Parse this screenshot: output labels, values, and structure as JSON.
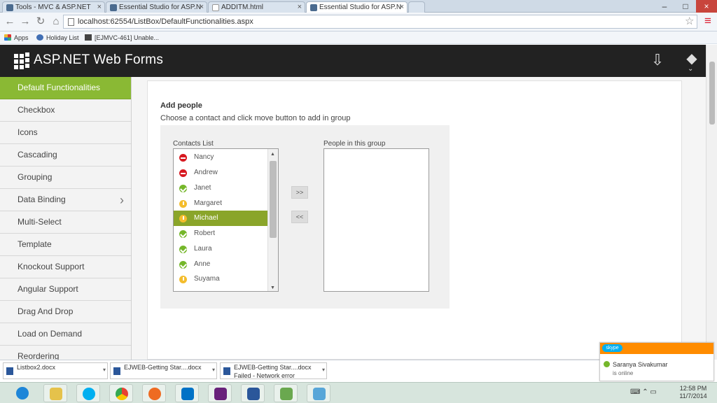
{
  "browser": {
    "tabs": [
      {
        "label": "Tools - MVC & ASP.NET ",
        "active": false
      },
      {
        "label": "Essential Studio for ASP.N",
        "active": false
      },
      {
        "label": "ADDITM.html",
        "active": false
      },
      {
        "label": "Essential Studio for ASP.N",
        "active": true
      }
    ],
    "address": "localhost:62554/ListBox/DefaultFunctionalities.aspx",
    "bookmarks": [
      "Apps",
      "Holiday List",
      "[EJMVC-461] Unable..."
    ]
  },
  "app": {
    "title": "ASP.NET Web Forms"
  },
  "sidebar": {
    "items": [
      {
        "label": "Default Functionalities",
        "active": true
      },
      {
        "label": "Checkbox"
      },
      {
        "label": "Icons"
      },
      {
        "label": "Cascading"
      },
      {
        "label": "Grouping"
      },
      {
        "label": "Data Binding",
        "has_chevron": true
      },
      {
        "label": "Multi-Select"
      },
      {
        "label": "Template"
      },
      {
        "label": "Knockout Support"
      },
      {
        "label": "Angular Support"
      },
      {
        "label": "Drag And Drop"
      },
      {
        "label": "Load on Demand"
      },
      {
        "label": "Reordering"
      }
    ]
  },
  "content": {
    "heading": "Add people",
    "description": "Choose a contact and click move button to add in group",
    "contacts_label": "Contacts List",
    "group_label": "People in this group",
    "move_right": ">>",
    "move_left": "<<",
    "contacts": [
      {
        "name": "Nancy",
        "status": "busy"
      },
      {
        "name": "Andrew",
        "status": "busy"
      },
      {
        "name": "Janet",
        "status": "online"
      },
      {
        "name": "Margaret",
        "status": "away"
      },
      {
        "name": "Michael",
        "status": "away",
        "selected": true
      },
      {
        "name": "Robert",
        "status": "online"
      },
      {
        "name": "Laura",
        "status": "online"
      },
      {
        "name": "Anne",
        "status": "online"
      },
      {
        "name": "Suyama",
        "status": "away"
      }
    ]
  },
  "downloads": [
    {
      "title": "Listbox2.docx",
      "subtitle": ""
    },
    {
      "title": "EJWEB-Getting Star....docx",
      "subtitle": ""
    },
    {
      "title": "EJWEB-Getting Star....docx",
      "subtitle": "Failed - Network error"
    }
  ],
  "skype": {
    "name": "Saranya Sivakumar",
    "status": "is online",
    "logo": "skype"
  },
  "clock": {
    "time": "12:58 PM",
    "date": "11/7/2014"
  },
  "colors": {
    "accent_green": "#8ab934",
    "selected_green": "#8aa52a",
    "header": "#222222"
  }
}
